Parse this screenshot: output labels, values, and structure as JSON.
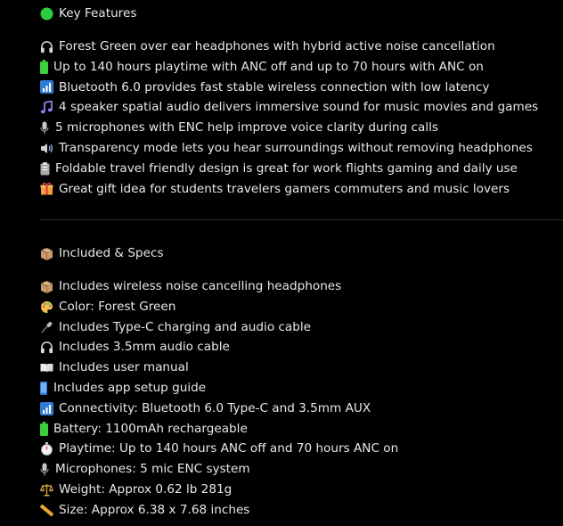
{
  "features": {
    "heading": "Key Features",
    "heading_icon": "green-circle-icon",
    "items": [
      {
        "icon": "headphones-icon",
        "text": "Forest Green over ear headphones with hybrid active noise cancellation"
      },
      {
        "icon": "battery-icon",
        "text": "Up to 140 hours playtime with ANC off and up to 70 hours with ANC on"
      },
      {
        "icon": "signal-bars-icon",
        "text": "Bluetooth 6.0 provides fast stable wireless connection with low latency"
      },
      {
        "icon": "music-note-icon",
        "text": "4 speaker spatial audio delivers immersive sound for music movies and games"
      },
      {
        "icon": "microphone-icon",
        "text": "5 microphones with ENC help improve voice clarity during calls"
      },
      {
        "icon": "speaker-icon",
        "text": "Transparency mode lets you hear surroundings without removing headphones"
      },
      {
        "icon": "clipboard-icon",
        "text": "Foldable travel friendly design is great for work flights gaming and daily use"
      },
      {
        "icon": "gift-icon",
        "text": "Great gift idea for students travelers gamers commuters and music lovers"
      }
    ]
  },
  "specs": {
    "heading": "Included & Specs",
    "heading_icon": "package-icon",
    "items": [
      {
        "icon": "package-icon",
        "text": "Includes wireless noise cancelling headphones"
      },
      {
        "icon": "palette-icon",
        "text": "Color: Forest Green"
      },
      {
        "icon": "cable-icon",
        "text": "Includes Type-C charging and audio cable"
      },
      {
        "icon": "headphones-icon",
        "text": "Includes 3.5mm audio cable"
      },
      {
        "icon": "book-icon",
        "text": "Includes user manual"
      },
      {
        "icon": "phone-icon",
        "text": "Includes app setup guide"
      },
      {
        "icon": "signal-bars-icon",
        "text": "Connectivity: Bluetooth 6.0 Type-C and 3.5mm AUX"
      },
      {
        "icon": "battery-icon",
        "text": "Battery: 1100mAh rechargeable"
      },
      {
        "icon": "stopwatch-icon",
        "text": "Playtime: Up to 140 hours ANC off and 70 hours ANC on"
      },
      {
        "icon": "microphone-icon",
        "text": "Microphones: 5 mic ENC system"
      },
      {
        "icon": "scales-icon",
        "text": "Weight: Approx 0.62 lb 281g"
      },
      {
        "icon": "ruler-icon",
        "text": "Size: Approx 6.38 x 7.68 inches"
      }
    ]
  },
  "colors": {
    "background": "#000000",
    "text": "#e8e8e8",
    "divider": "#2e2e2e",
    "green_dot": "#2ecc40"
  }
}
